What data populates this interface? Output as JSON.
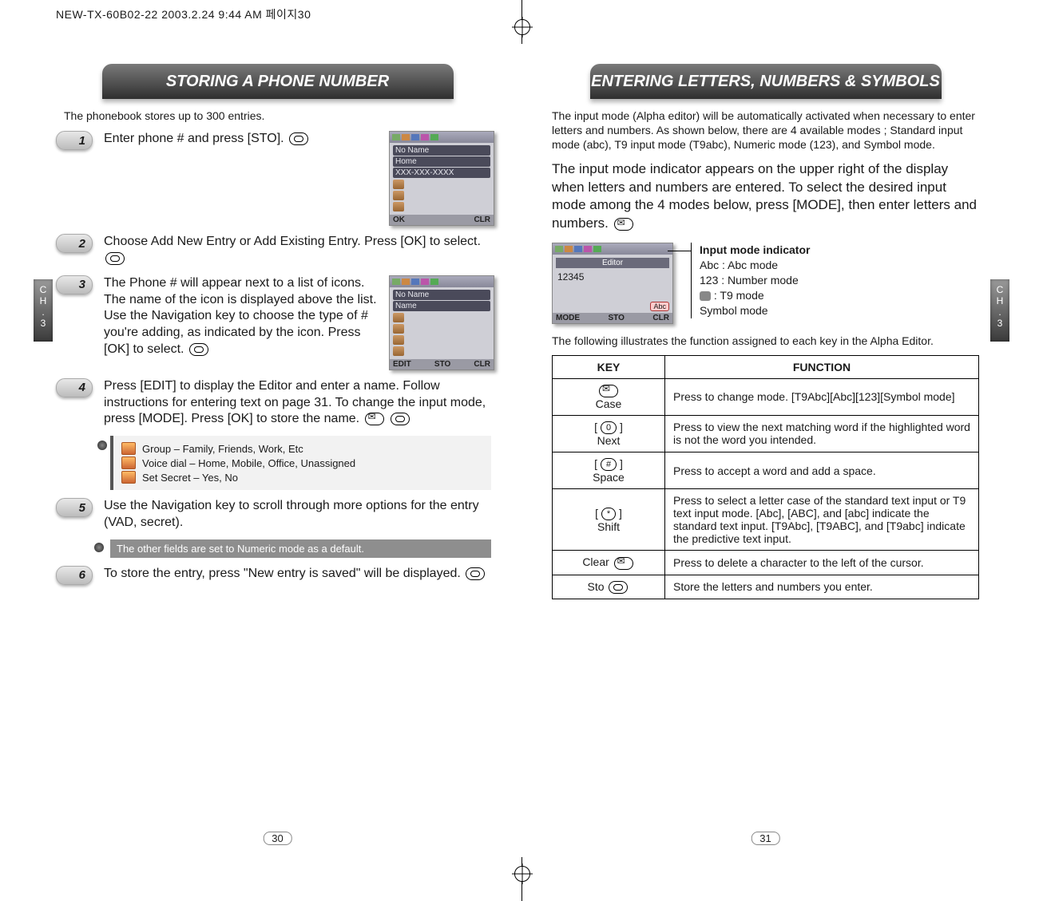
{
  "doc_header": "NEW-TX-60B02-22  2003.2.24 9:44 AM  페이지30",
  "left_tab": {
    "line1": "C",
    "line2": "H",
    "dot": ".",
    "line3": "3"
  },
  "right_tab": {
    "line1": "C",
    "line2": "H",
    "dot": ".",
    "line3": "3"
  },
  "left": {
    "title": "STORING A PHONE NUMBER",
    "intro": "The phonebook stores up to 300 entries.",
    "steps": {
      "s1": "Enter phone # and press       [STO].",
      "s2": "Choose Add New Entry or Add Existing Entry. Press       [OK] to select.",
      "s3": "The Phone # will appear next to a list of icons. The name of the icon is displayed above the list. Use the Navigation key to choose the type of # you're adding, as indicated by the icon. Press        [OK] to select.",
      "s4": "Press        [EDIT] to display the Editor and enter a name. Follow instructions for entering text on page 31. To change the input mode, press        [MODE]. Press        [OK] to store the name.",
      "s5": "Use the Navigation key to scroll through more options for the entry (VAD, secret).",
      "s6": "To store the entry, press       \"New entry is saved\" will be displayed."
    },
    "tips": {
      "t1": "Group – Family, Friends, Work, Etc",
      "t2": "Voice dial – Home, Mobile, Office, Unassigned",
      "t3": "Set Secret – Yes, No"
    },
    "note": "The other fields are set to Numeric mode as a default.",
    "screen1": {
      "line1": "No Name",
      "line2": "Home",
      "line3": "XXX-XXX-XXXX",
      "soft_left": "OK",
      "soft_right": "CLR"
    },
    "screen2": {
      "line1": "No Name",
      "line2": "Name",
      "soft_left": "EDIT",
      "soft_mid": "STO",
      "soft_right": "CLR"
    },
    "page_num": "30"
  },
  "right": {
    "title": "ENTERING LETTERS, NUMBERS & SYMBOLS",
    "intro": "The input mode (Alpha editor) will be automatically activated when necessary to enter letters and numbers. As shown below, there are 4 available modes ; Standard input mode (abc), T9 input mode (T9abc), Numeric mode (123), and Symbol mode.",
    "big_p": "The input mode indicator appears on the upper right of the display when letters and numbers are entered. To select the desired input mode among the 4 modes below, press        [MODE], then enter letters and numbers.",
    "screen": {
      "title": "Editor",
      "value": "12345",
      "soft_left": "MODE",
      "soft_mid": "STO",
      "soft_right": "CLR"
    },
    "callout": {
      "head": "Input mode indicator",
      "l1": "Abc : Abc mode",
      "l2": "123 : Number mode",
      "l3": "   : T9 mode",
      "l4": "Symbol mode"
    },
    "table_intro": "The following illustrates the function assigned to each key in the Alpha Editor.",
    "table": {
      "head_key": "KEY",
      "head_fn": "FUNCTION",
      "rows": [
        {
          "key": "Case",
          "fn": "Press to change mode. [T9Abc][Abc][123][Symbol mode]"
        },
        {
          "key": "Next",
          "bracket": "[ 0 ]",
          "fn": "Press to view the next matching word if the highlighted word is not the word you intended."
        },
        {
          "key": "Space",
          "bracket": "[ # ]",
          "fn": "Press to accept a word and add a space."
        },
        {
          "key": "Shift",
          "bracket": "[ * ]",
          "fn": "Press to select a letter case of the standard text input or T9  text input mode. [Abc], [ABC], and [abc] indicate the standard text input. [T9Abc], [T9ABC], and [T9abc] indicate the predictive text input."
        },
        {
          "key": "Clear",
          "fn": "Press to delete a character to the left of the cursor."
        },
        {
          "key": "Sto",
          "fn": "Store the letters and numbers you enter."
        }
      ]
    },
    "page_num": "31"
  }
}
